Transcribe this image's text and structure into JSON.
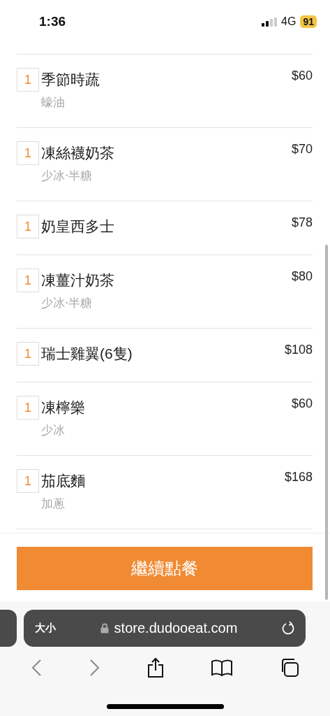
{
  "status_bar": {
    "time": "1:36",
    "network": "4G",
    "battery": "91"
  },
  "items": [
    {
      "quantity": "1",
      "name": "季節時蔬",
      "note": "蠔油",
      "price": "$60"
    },
    {
      "quantity": "1",
      "name": "凍絲襪奶茶",
      "note": "少冰‧半糖",
      "price": "$70"
    },
    {
      "quantity": "1",
      "name": "奶皇西多士",
      "price": "$78"
    },
    {
      "quantity": "1",
      "name": "凍薑汁奶茶",
      "note": "少冰‧半糖",
      "price": "$80"
    },
    {
      "quantity": "1",
      "name": "瑞士雞翼(6隻)",
      "price": "$108"
    },
    {
      "quantity": "1",
      "name": "凍檸樂",
      "note": "少冰",
      "price": "$60"
    },
    {
      "quantity": "1",
      "name": "茄底麵",
      "note": "加蔥",
      "price": "$168"
    }
  ],
  "continue_button": "繼續點餐",
  "browser": {
    "text_size": "大小",
    "url": "store.dudooeat.com"
  }
}
